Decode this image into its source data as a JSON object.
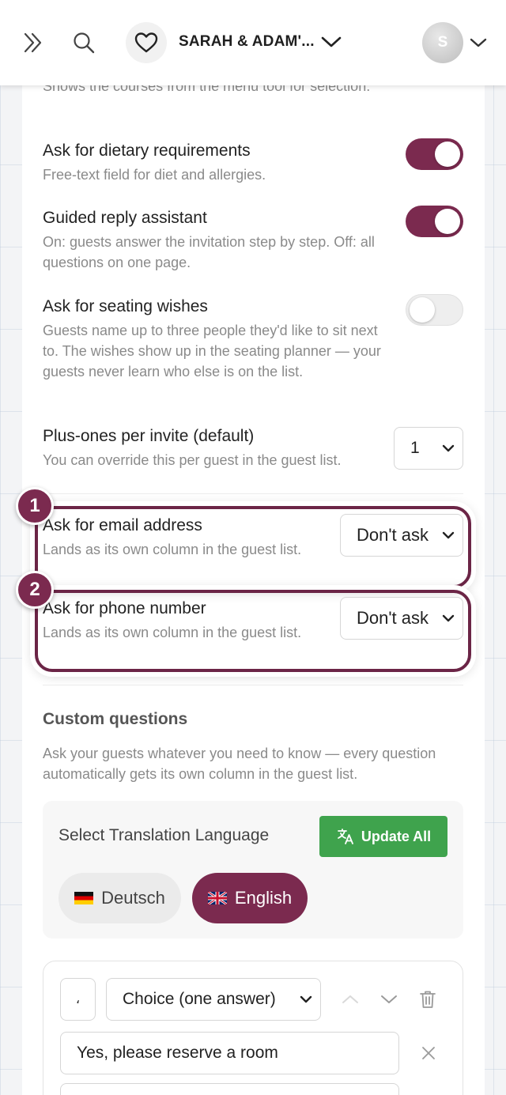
{
  "header": {
    "event_name": "SARAH & ADAM'...",
    "avatar_initial": "S"
  },
  "settings": {
    "courses_desc": "Shows the courses from the menu tool for selection.",
    "dietary": {
      "title": "Ask for dietary requirements",
      "desc": "Free-text field for diet and allergies.",
      "enabled": true
    },
    "guided": {
      "title": "Guided reply assistant",
      "desc": "On: guests answer the invitation step by step. Off: all questions on one page.",
      "enabled": true
    },
    "seating": {
      "title": "Ask for seating wishes",
      "desc": "Guests name up to three people they'd like to sit next to. The wishes show up in the seating planner — your guests never learn who else is on the list.",
      "enabled": false
    },
    "plus_ones": {
      "title": "Plus-ones per invite (default)",
      "desc": "You can override this per guest in the guest list.",
      "value": "1"
    },
    "email": {
      "badge": "1",
      "title": "Ask for email address",
      "desc": "Lands as its own column in the guest list.",
      "value": "Don't ask"
    },
    "phone": {
      "badge": "2",
      "title": "Ask for phone number",
      "desc": "Lands as its own column in the guest list.",
      "value": "Don't ask"
    }
  },
  "custom_questions": {
    "title": "Custom questions",
    "desc": "Ask your guests whatever you need to know — every question automatically gets its own column in the guest list.",
    "translation": {
      "label": "Select Translation Language",
      "update_label": "Update All",
      "languages": [
        {
          "label": "Deutsch",
          "active": false
        },
        {
          "label": "English",
          "active": true
        }
      ]
    },
    "question": {
      "icon_value": "،",
      "type_value": "Choice (one answer)",
      "options": [
        "Yes, please reserve a room"
      ]
    }
  },
  "colors": {
    "accent": "#7b2a4f",
    "update_button": "#3fa34d"
  }
}
